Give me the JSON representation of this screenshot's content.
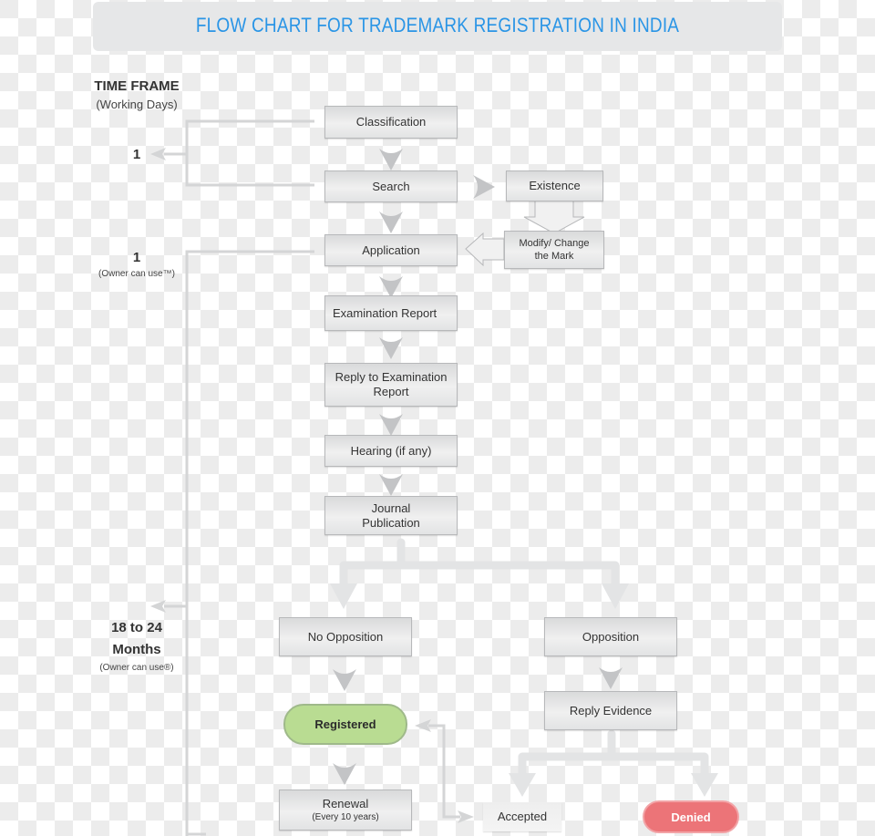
{
  "title": "FLOW CHART FOR TRADEMARK REGISTRATION IN INDIA",
  "time_frame": {
    "heading": "TIME FRAME",
    "subheading": "(Working Days)",
    "stage1": {
      "value": "1"
    },
    "stage2": {
      "value": "1",
      "note": "(Owner can use™)"
    },
    "stage3": {
      "value_line1": "18 to 24",
      "value_line2": "Months",
      "note": "(Owner can use®)"
    }
  },
  "steps": {
    "classification": "Classification",
    "search": "Search",
    "existence": "Existence",
    "modify_line1": "Modify/ Change",
    "modify_line2": "the Mark",
    "application": "Application",
    "examination_report": "Examination Report",
    "reply_exam_line1": "Reply to Examination",
    "reply_exam_line2": "Report",
    "hearing": "Hearing (if any)",
    "journal_line1": "Journal",
    "journal_line2": "Publication",
    "no_opposition": "No Opposition",
    "opposition": "Opposition",
    "registered": "Registered",
    "reply_evidence": "Reply Evidence",
    "renewal": "Renewal",
    "renewal_note": "(Every 10 years)",
    "accepted": "Accepted",
    "denied": "Denied"
  },
  "colors": {
    "title": "#2a95e6",
    "registered": "#b9dc92",
    "denied": "#ec7478",
    "box": "#e6e7e8",
    "connector": "#d6d7d8"
  }
}
